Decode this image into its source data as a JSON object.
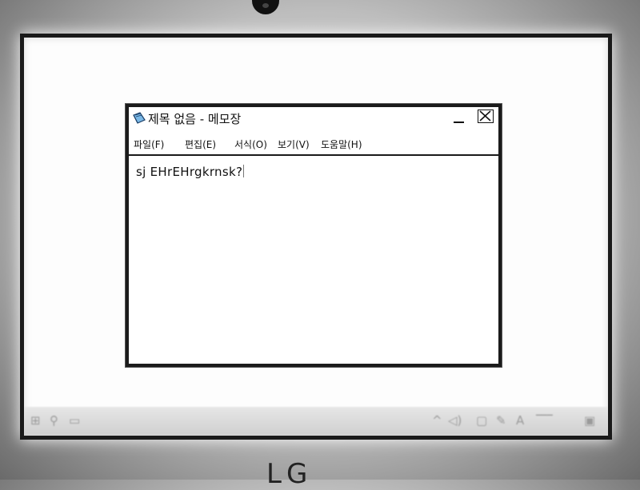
{
  "window": {
    "title": "제목 없음 - 메모장",
    "menu": [
      "파일(F)",
      "편집(E)",
      "서식(O)",
      "보기(V)",
      "도움말(H)"
    ]
  },
  "editor": {
    "content": "sj EHrEHrgkrnsk?"
  },
  "taskbar": {
    "left_icons": [
      "windows-start-icon",
      "search-icon",
      "task-view-icon"
    ],
    "tray_icons": [
      "chevron-up-icon",
      "network-icon",
      "speaker-icon",
      "pen-icon",
      "ime-icon",
      "notification-icon"
    ],
    "ime_label": "A"
  },
  "monitor": {
    "brand": "LG"
  },
  "colors": {
    "outline": "#1a1a1a",
    "paper": "#ffffff"
  }
}
